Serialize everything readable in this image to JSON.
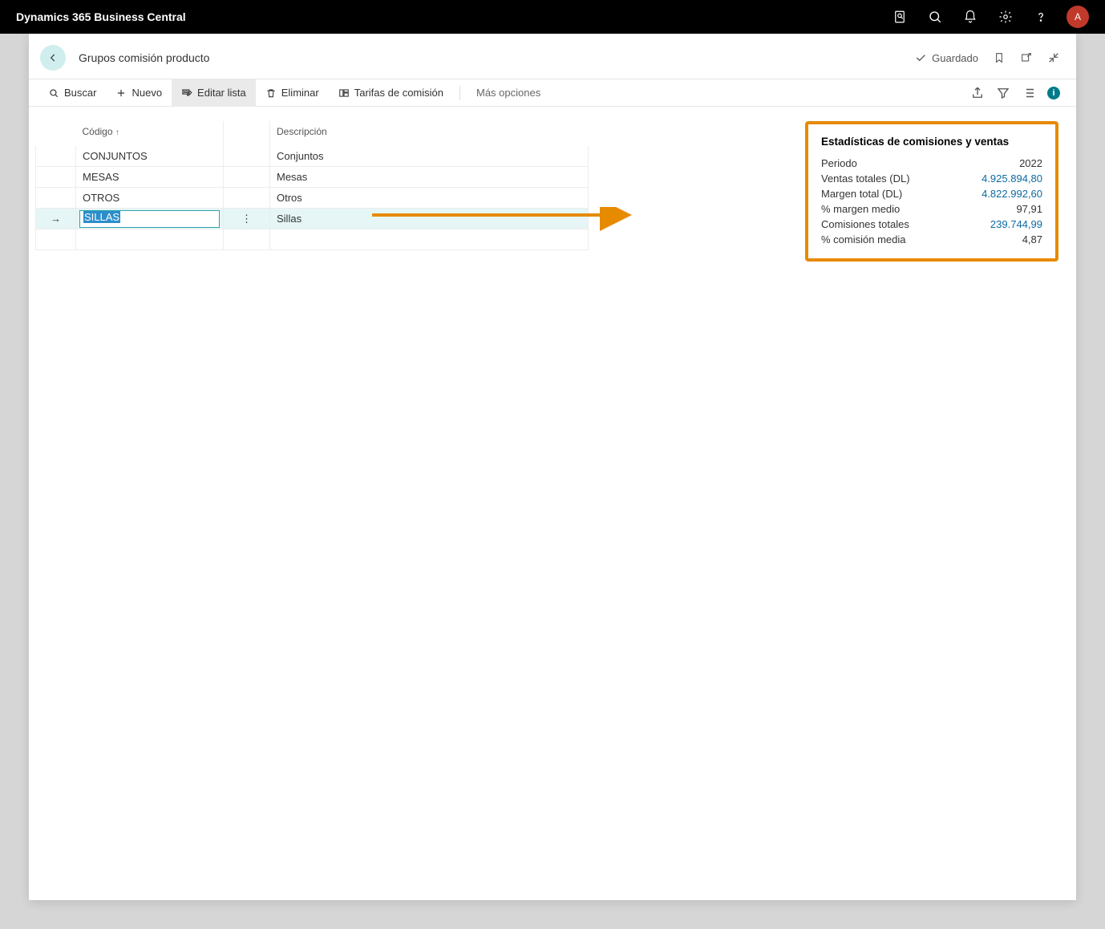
{
  "app_title": "Dynamics 365 Business Central",
  "avatar_initial": "A",
  "page": {
    "title": "Grupos comisión producto",
    "saved_label": "Guardado"
  },
  "toolbar": {
    "search": "Buscar",
    "new": "Nuevo",
    "edit_list": "Editar lista",
    "delete": "Eliminar",
    "commission_rates": "Tarifas de comisión",
    "more_options": "Más opciones"
  },
  "grid": {
    "col_codigo": "Código",
    "col_desc": "Descripción",
    "rows": [
      {
        "codigo": "CONJUNTOS",
        "desc": "Conjuntos"
      },
      {
        "codigo": "MESAS",
        "desc": "Mesas"
      },
      {
        "codigo": "OTROS",
        "desc": "Otros"
      },
      {
        "codigo": "SILLAS",
        "desc": "Sillas"
      }
    ],
    "selected_codigo": "SILLAS"
  },
  "stats": {
    "title": "Estadísticas de comisiones y ventas",
    "periodo_label": "Periodo",
    "periodo_val": "2022",
    "ventas_label": "Ventas totales (DL)",
    "ventas_val": "4.925.894,80",
    "margen_label": "Margen total (DL)",
    "margen_val": "4.822.992,60",
    "pct_margen_label": "% margen medio",
    "pct_margen_val": "97,91",
    "comisiones_label": "Comisiones totales",
    "comisiones_val": "239.744,99",
    "pct_comision_label": "% comisión media",
    "pct_comision_val": "4,87"
  }
}
